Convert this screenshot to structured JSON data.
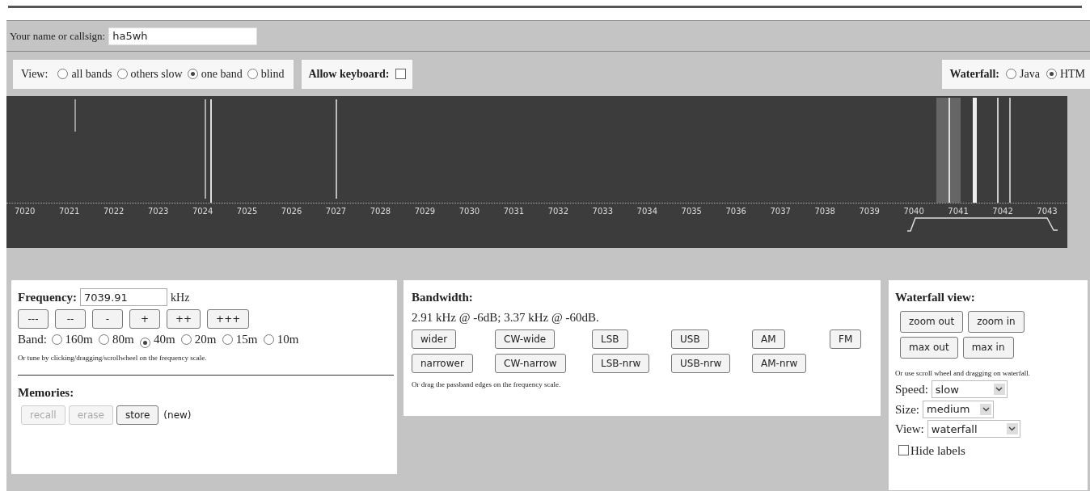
{
  "callsign": {
    "label": "Your name or callsign:",
    "value": "ha5wh"
  },
  "view": {
    "label": "View:",
    "options": [
      {
        "label": "all bands",
        "selected": false
      },
      {
        "label": "others slow",
        "selected": false
      },
      {
        "label": "one band",
        "selected": true
      },
      {
        "label": "blind",
        "selected": false
      }
    ]
  },
  "allow_keyboard": {
    "label": "Allow keyboard:",
    "checked": false
  },
  "waterfall_mode": {
    "label": "Waterfall:",
    "options": [
      {
        "label": "Java",
        "selected": false
      },
      {
        "label": "HTM",
        "selected": true
      }
    ]
  },
  "waterfall": {
    "scale_labels": [
      "7020",
      "7021",
      "7022",
      "7023",
      "7024",
      "7025",
      "7026",
      "7027",
      "7028",
      "7029",
      "7030",
      "7031",
      "7032",
      "7033",
      "7034",
      "7035",
      "7036",
      "7037",
      "7038",
      "7039",
      "7040",
      "7041",
      "7042",
      "7043"
    ]
  },
  "frequency": {
    "label": "Frequency:",
    "value": "7039.91",
    "unit": "kHz",
    "step_buttons": [
      "---",
      "--",
      "-",
      "+",
      "++",
      "+++"
    ],
    "band_label": "Band:",
    "bands": [
      {
        "label": "160m",
        "selected": false
      },
      {
        "label": "80m",
        "selected": false
      },
      {
        "label": "40m",
        "selected": true
      },
      {
        "label": "20m",
        "selected": false
      },
      {
        "label": "15m",
        "selected": false
      },
      {
        "label": "10m",
        "selected": false
      }
    ],
    "hint": "Or tune by clicking/dragging/scrollwheel on the frequency scale."
  },
  "memories": {
    "label": "Memories:",
    "buttons": [
      {
        "label": "recall",
        "disabled": true
      },
      {
        "label": "erase",
        "disabled": true
      },
      {
        "label": "store",
        "disabled": false
      }
    ],
    "note": "(new)"
  },
  "bandwidth": {
    "label": "Bandwidth:",
    "reading": "2.91 kHz @ -6dB; 3.37 kHz @ -60dB.",
    "rows": [
      [
        "wider",
        "CW-wide",
        "LSB",
        "USB",
        "AM",
        "FM"
      ],
      [
        "narrower",
        "CW-narrow",
        "LSB-nrw",
        "USB-nrw",
        "AM-nrw"
      ]
    ],
    "hint": "Or drag the passband edges on the frequency scale."
  },
  "waterfall_view": {
    "label": "Waterfall view:",
    "rows": [
      [
        "zoom out",
        "zoom in"
      ],
      [
        "max out",
        "max in"
      ]
    ],
    "hint": "Or use scroll wheel and dragging on waterfall.",
    "selects": [
      {
        "label": "Speed:",
        "value": "slow"
      },
      {
        "label": "Size:",
        "value": "medium"
      },
      {
        "label": "View:",
        "value": "waterfall"
      }
    ],
    "hide_labels": {
      "label": "Hide labels",
      "checked": false
    }
  }
}
